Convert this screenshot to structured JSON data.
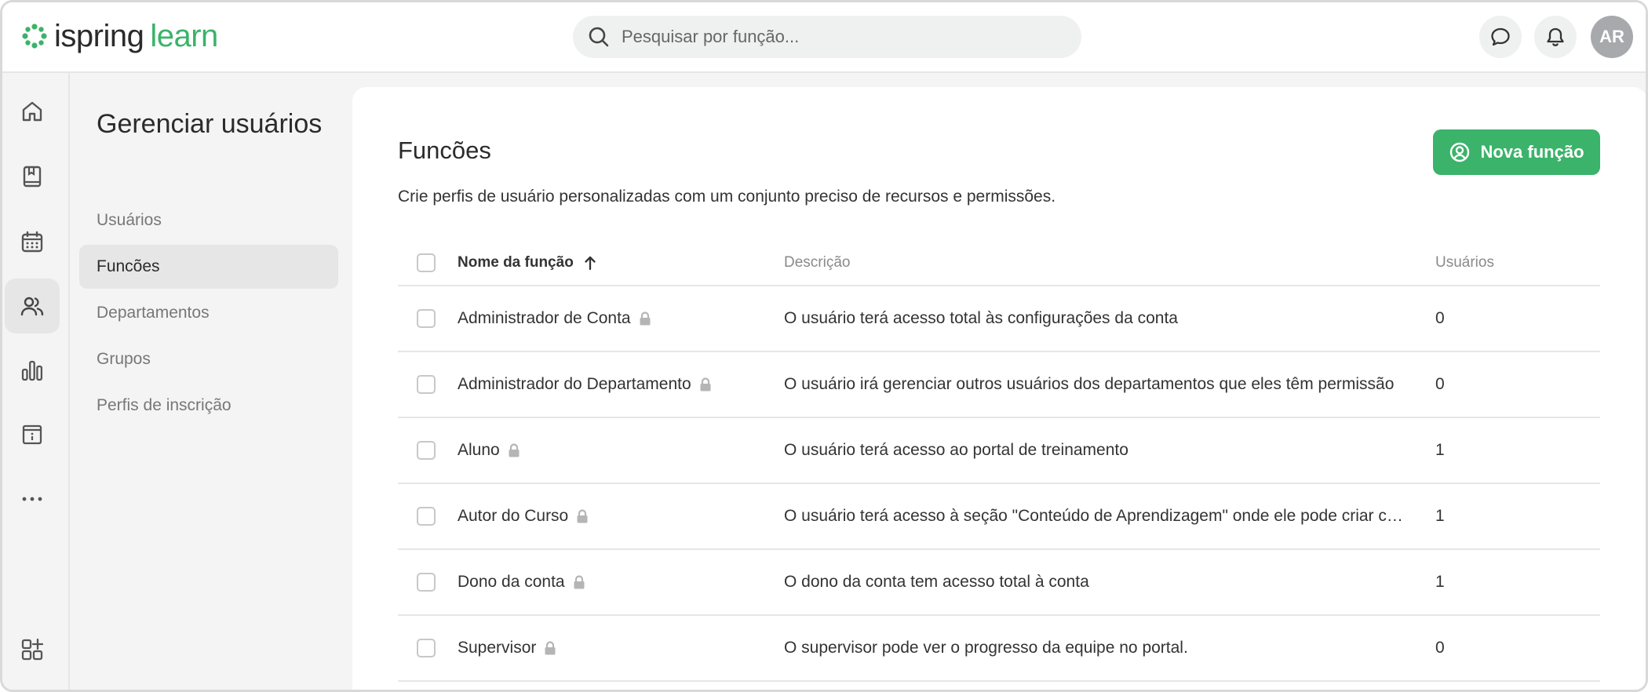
{
  "brand": {
    "name_part1": "ispring",
    "name_part2": "learn",
    "accent": "#3bb36a"
  },
  "search": {
    "placeholder": "Pesquisar por função..."
  },
  "header": {
    "avatar_initials": "AR",
    "chat_icon": "chat-bubble-icon",
    "bell_icon": "bell-icon"
  },
  "rail": {
    "items": [
      {
        "icon": "home-icon",
        "active": false
      },
      {
        "icon": "book-icon",
        "active": false
      },
      {
        "icon": "calendar-icon",
        "active": false
      },
      {
        "icon": "users-icon",
        "active": true
      },
      {
        "icon": "bar-chart-icon",
        "active": false
      },
      {
        "icon": "info-box-icon",
        "active": false
      },
      {
        "icon": "more-icon",
        "active": false
      },
      {
        "icon": "add-apps-icon",
        "active": false
      }
    ]
  },
  "subnav": {
    "title": "Gerenciar usuários",
    "items": [
      {
        "label": "Usuários",
        "active": false
      },
      {
        "label": "Funcões",
        "active": true
      },
      {
        "label": "Departamentos",
        "active": false
      },
      {
        "label": "Grupos",
        "active": false
      },
      {
        "label": "Perfis de inscrição",
        "active": false
      }
    ]
  },
  "main": {
    "title": "Funcões",
    "subtitle": "Crie perfis de usuário personalizadas com um conjunto preciso de recursos e permissões.",
    "new_button": "Nova função",
    "columns": {
      "name": "Nome da função",
      "description": "Descrição",
      "users": "Usuários"
    },
    "rows": [
      {
        "name": "Administrador de Conta",
        "description": "O usuário terá acesso total às configurações da conta",
        "users": "0"
      },
      {
        "name": "Administrador do Departamento",
        "description": "O usuário irá gerenciar outros usuários dos departamentos que eles têm permissão",
        "users": "0"
      },
      {
        "name": "Aluno",
        "description": "O usuário terá acesso ao portal de treinamento",
        "users": "1"
      },
      {
        "name": "Autor do Curso",
        "description": "O usuário terá acesso à seção \"Conteúdo de Aprendizagem\" onde ele pode criar cursos",
        "users": "1"
      },
      {
        "name": "Dono da conta",
        "description": "O dono da conta tem acesso total à conta",
        "users": "1"
      },
      {
        "name": "Supervisor",
        "description": "O supervisor pode ver o progresso da equipe no portal.",
        "users": "0"
      }
    ]
  }
}
